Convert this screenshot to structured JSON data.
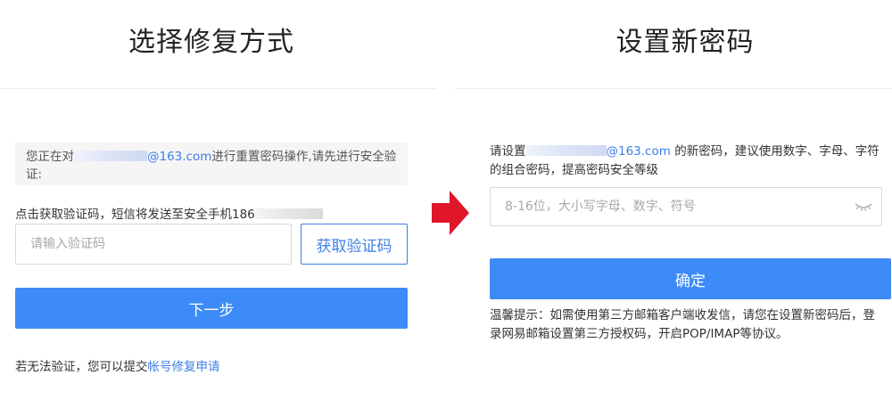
{
  "left": {
    "title": "选择修复方式",
    "notice": {
      "prefix": "您正在对",
      "email_domain": "@163.com",
      "suffix": "进行重置密码操作,请先进行安全验证:"
    },
    "sms_hint": {
      "text": "点击获取验证码，短信将发送至安全手机",
      "phone_prefix": "186"
    },
    "code_input": {
      "placeholder": "请输入验证码",
      "value": ""
    },
    "get_code_label": "获取验证码",
    "next_label": "下一步",
    "recover": {
      "text": "若无法验证，您可以提交",
      "link": "帐号修复申请"
    }
  },
  "right": {
    "title": "设置新密码",
    "desc": {
      "prefix": "请设置",
      "email_domain": "@163.com",
      "suffix": " 的新密码，建议使用数字、字母、字符的组合密码，提高密码安全等级"
    },
    "password_input": {
      "placeholder": "8-16位，大小写字母、数字、符号",
      "value": ""
    },
    "confirm_label": "确定",
    "tip": "温馨提示：如需使用第三方邮箱客户端收发信，请您在设置新密码后，登录网易邮箱设置第三方授权码，开启POP/IMAP等协议。"
  },
  "icons": {
    "arrow": "arrow-right-icon",
    "eye": "eye-closed-icon"
  },
  "colors": {
    "primary": "#3d8bf7",
    "link": "#3d7fe6",
    "arrow": "#e0162b"
  }
}
